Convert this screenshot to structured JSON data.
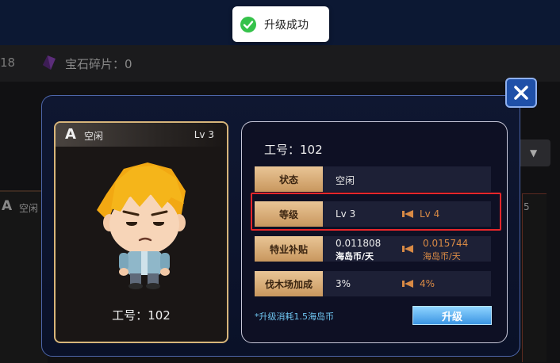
{
  "background": {
    "partial_count": "18",
    "gem_label": "宝石碎片：0",
    "side_status": "空闲",
    "side_grade": "A",
    "right_digit": "5"
  },
  "toast": {
    "text": "升级成功",
    "icon": "check-circle-icon",
    "icon_color": "#35c24a"
  },
  "card": {
    "grade": "A",
    "status": "空闲",
    "level": "Lv 3",
    "employee_id": "工号：102",
    "border_color": "#d7b57a"
  },
  "info": {
    "employee_id": "工号：102",
    "rows": [
      {
        "label": "状态",
        "value": "空闲"
      },
      {
        "label": "等级",
        "value": "Lv 3",
        "new_value": "Lv 4"
      },
      {
        "label": "特业补贴",
        "value": "0.011808",
        "unit": "海岛币/天",
        "new_value": "0.015744",
        "new_unit": "海岛币/天"
      },
      {
        "label": "伐木场加成",
        "value": "3%",
        "new_value": "4%"
      }
    ],
    "cost_note": "*升级消耗1.5海岛币",
    "upgrade_button": "升级"
  },
  "colors": {
    "accent_gold": "#d7b57a",
    "increase_orange": "#d98a45",
    "button_blue": "#3b95e3",
    "highlight_red": "#e8262a"
  }
}
